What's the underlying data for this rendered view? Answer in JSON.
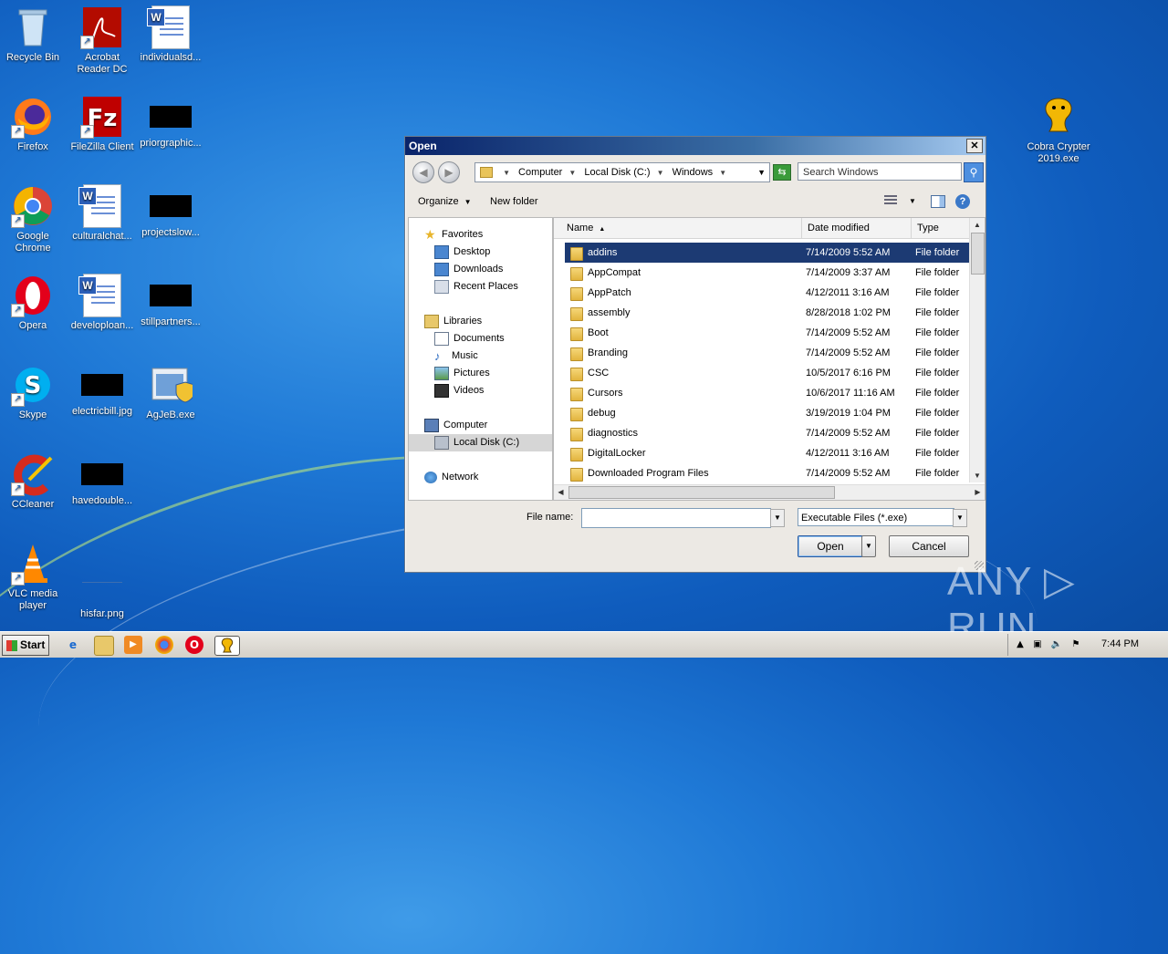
{
  "desktop": {
    "icons": [
      {
        "label": "Recycle Bin"
      },
      {
        "label": "Acrobat Reader DC"
      },
      {
        "label": "individualsd..."
      },
      {
        "label": "Firefox"
      },
      {
        "label": "FileZilla Client"
      },
      {
        "label": "priorgraphic..."
      },
      {
        "label": "Google Chrome"
      },
      {
        "label": "culturalchat..."
      },
      {
        "label": "projectslow..."
      },
      {
        "label": "Opera"
      },
      {
        "label": "developloan..."
      },
      {
        "label": "stillpartners..."
      },
      {
        "label": "Skype"
      },
      {
        "label": "electricbill.jpg"
      },
      {
        "label": "AgJeB.exe"
      },
      {
        "label": "CCleaner"
      },
      {
        "label": "havedouble..."
      },
      {
        "label": "VLC media player"
      },
      {
        "label": "hisfar.png"
      },
      {
        "label": "Cobra Crypter 2019.exe"
      }
    ]
  },
  "dialog": {
    "title": "Open",
    "close": "✕",
    "address": {
      "crumbs": [
        "Computer",
        "Local Disk (C:)",
        "Windows"
      ]
    },
    "search_placeholder": "Search Windows",
    "toolbar": {
      "organize": "Organize",
      "new_folder": "New folder"
    },
    "nav": {
      "items": [
        {
          "label": "Favorites",
          "icon": "star-icon"
        },
        {
          "label": "Desktop",
          "icon": "desktop-icon"
        },
        {
          "label": "Downloads",
          "icon": "downloads-icon"
        },
        {
          "label": "Recent Places",
          "icon": "recent-places-icon"
        },
        {
          "label": "Libraries",
          "icon": "libraries-icon"
        },
        {
          "label": "Documents",
          "icon": "documents-icon"
        },
        {
          "label": "Music",
          "icon": "music-icon"
        },
        {
          "label": "Pictures",
          "icon": "pictures-icon"
        },
        {
          "label": "Videos",
          "icon": "videos-icon"
        },
        {
          "label": "Computer",
          "icon": "computer-icon"
        },
        {
          "label": "Local Disk (C:)",
          "icon": "disk-icon"
        },
        {
          "label": "Network",
          "icon": "network-icon"
        }
      ]
    },
    "columns": {
      "name": "Name",
      "date": "Date modified",
      "type": "Type"
    },
    "files": [
      {
        "name": "addins",
        "date": "7/14/2009 5:52 AM",
        "type": "File folder"
      },
      {
        "name": "AppCompat",
        "date": "7/14/2009 3:37 AM",
        "type": "File folder"
      },
      {
        "name": "AppPatch",
        "date": "4/12/2011 3:16 AM",
        "type": "File folder"
      },
      {
        "name": "assembly",
        "date": "8/28/2018 1:02 PM",
        "type": "File folder"
      },
      {
        "name": "Boot",
        "date": "7/14/2009 5:52 AM",
        "type": "File folder"
      },
      {
        "name": "Branding",
        "date": "7/14/2009 5:52 AM",
        "type": "File folder"
      },
      {
        "name": "CSC",
        "date": "10/5/2017 6:16 PM",
        "type": "File folder"
      },
      {
        "name": "Cursors",
        "date": "10/6/2017 11:16 AM",
        "type": "File folder"
      },
      {
        "name": "debug",
        "date": "3/19/2019 1:04 PM",
        "type": "File folder"
      },
      {
        "name": "diagnostics",
        "date": "7/14/2009 5:52 AM",
        "type": "File folder"
      },
      {
        "name": "DigitalLocker",
        "date": "4/12/2011 3:16 AM",
        "type": "File folder"
      },
      {
        "name": "Downloaded Program Files",
        "date": "7/14/2009 5:52 AM",
        "type": "File folder"
      }
    ],
    "file_name_label": "File name:",
    "file_name_value": "",
    "file_type": "Executable Files (*.exe)",
    "open_label": "Open",
    "cancel_label": "Cancel"
  },
  "taskbar": {
    "start_label": "Start",
    "clock": "7:44 PM"
  },
  "watermark": "ANY ▷ RUN",
  "colors": {
    "selection": "#1c3a73",
    "title_start": "#0a246a"
  }
}
